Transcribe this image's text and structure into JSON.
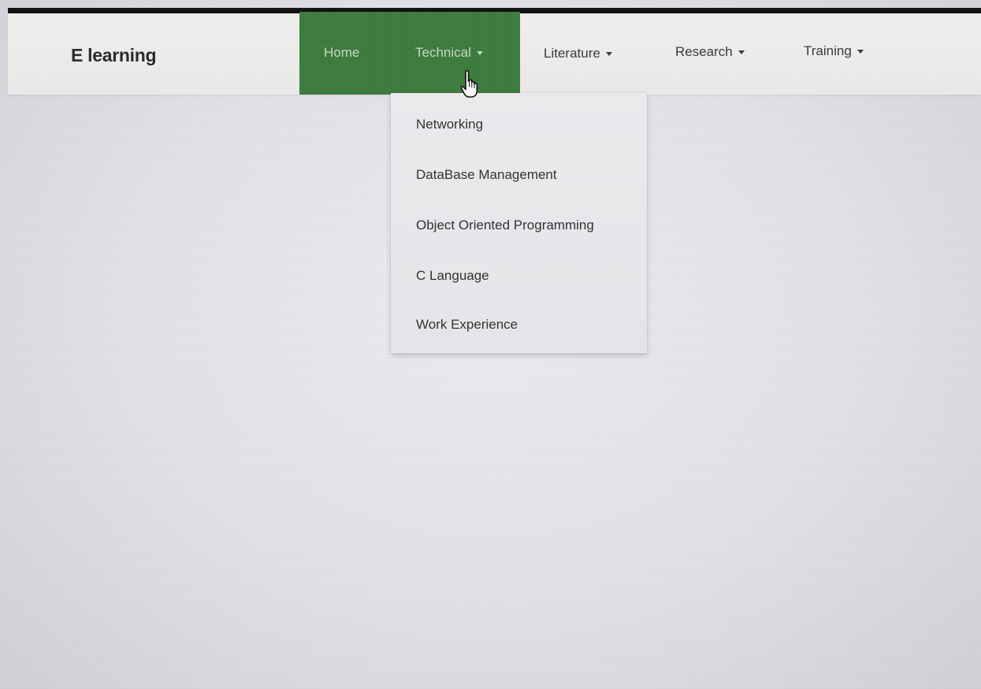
{
  "brand": {
    "title": "E learning"
  },
  "nav": {
    "home": "Home",
    "technical": "Technical",
    "literature": "Literature",
    "research": "Research",
    "training": "Training"
  },
  "technical_menu": {
    "items": [
      "Networking",
      "DataBase Management",
      "Object Oriented Programming",
      "C Language",
      "Work Experience"
    ]
  },
  "colors": {
    "active_nav_bg": "#3f7d40",
    "navbar_bg": "#efeeed",
    "page_bg": "#e4e2e7"
  },
  "icons": {
    "cursor": "hand-pointer-icon",
    "dropdown": "caret-down-icon"
  }
}
